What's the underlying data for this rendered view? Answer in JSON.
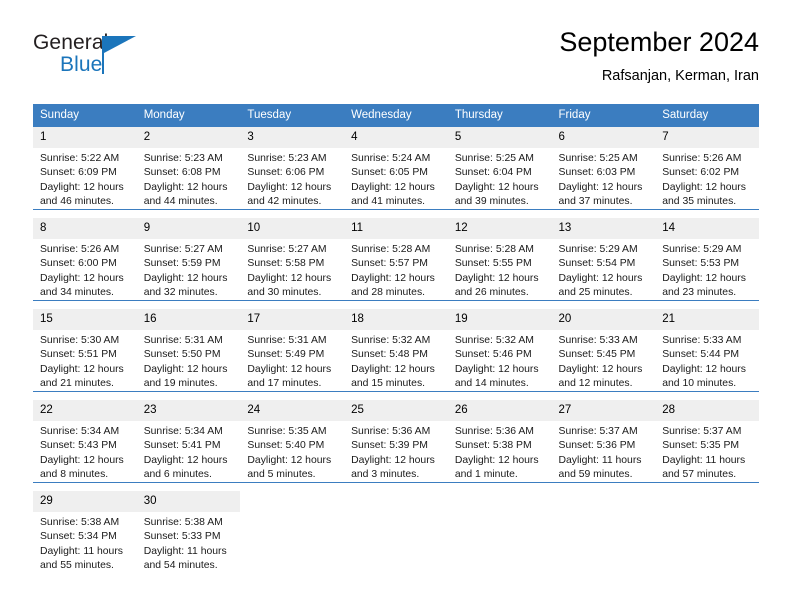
{
  "brand": {
    "name_part1": "General",
    "name_part2": "Blue",
    "flag_icon": "blue-flag-icon",
    "accent_color": "#1b75bb"
  },
  "header": {
    "title": "September 2024",
    "subtitle": "Rafsanjan, Kerman, Iran"
  },
  "calendar": {
    "header_bg": "#3b7dc0",
    "daynum_bg": "#efefef",
    "separator_color": "#3b7dc0",
    "weekday_headers": [
      "Sunday",
      "Monday",
      "Tuesday",
      "Wednesday",
      "Thursday",
      "Friday",
      "Saturday"
    ],
    "weeks": [
      [
        {
          "day": "1",
          "sunrise": "Sunrise: 5:22 AM",
          "sunset": "Sunset: 6:09 PM",
          "daylight1": "Daylight: 12 hours",
          "daylight2": "and 46 minutes."
        },
        {
          "day": "2",
          "sunrise": "Sunrise: 5:23 AM",
          "sunset": "Sunset: 6:08 PM",
          "daylight1": "Daylight: 12 hours",
          "daylight2": "and 44 minutes."
        },
        {
          "day": "3",
          "sunrise": "Sunrise: 5:23 AM",
          "sunset": "Sunset: 6:06 PM",
          "daylight1": "Daylight: 12 hours",
          "daylight2": "and 42 minutes."
        },
        {
          "day": "4",
          "sunrise": "Sunrise: 5:24 AM",
          "sunset": "Sunset: 6:05 PM",
          "daylight1": "Daylight: 12 hours",
          "daylight2": "and 41 minutes."
        },
        {
          "day": "5",
          "sunrise": "Sunrise: 5:25 AM",
          "sunset": "Sunset: 6:04 PM",
          "daylight1": "Daylight: 12 hours",
          "daylight2": "and 39 minutes."
        },
        {
          "day": "6",
          "sunrise": "Sunrise: 5:25 AM",
          "sunset": "Sunset: 6:03 PM",
          "daylight1": "Daylight: 12 hours",
          "daylight2": "and 37 minutes."
        },
        {
          "day": "7",
          "sunrise": "Sunrise: 5:26 AM",
          "sunset": "Sunset: 6:02 PM",
          "daylight1": "Daylight: 12 hours",
          "daylight2": "and 35 minutes."
        }
      ],
      [
        {
          "day": "8",
          "sunrise": "Sunrise: 5:26 AM",
          "sunset": "Sunset: 6:00 PM",
          "daylight1": "Daylight: 12 hours",
          "daylight2": "and 34 minutes."
        },
        {
          "day": "9",
          "sunrise": "Sunrise: 5:27 AM",
          "sunset": "Sunset: 5:59 PM",
          "daylight1": "Daylight: 12 hours",
          "daylight2": "and 32 minutes."
        },
        {
          "day": "10",
          "sunrise": "Sunrise: 5:27 AM",
          "sunset": "Sunset: 5:58 PM",
          "daylight1": "Daylight: 12 hours",
          "daylight2": "and 30 minutes."
        },
        {
          "day": "11",
          "sunrise": "Sunrise: 5:28 AM",
          "sunset": "Sunset: 5:57 PM",
          "daylight1": "Daylight: 12 hours",
          "daylight2": "and 28 minutes."
        },
        {
          "day": "12",
          "sunrise": "Sunrise: 5:28 AM",
          "sunset": "Sunset: 5:55 PM",
          "daylight1": "Daylight: 12 hours",
          "daylight2": "and 26 minutes."
        },
        {
          "day": "13",
          "sunrise": "Sunrise: 5:29 AM",
          "sunset": "Sunset: 5:54 PM",
          "daylight1": "Daylight: 12 hours",
          "daylight2": "and 25 minutes."
        },
        {
          "day": "14",
          "sunrise": "Sunrise: 5:29 AM",
          "sunset": "Sunset: 5:53 PM",
          "daylight1": "Daylight: 12 hours",
          "daylight2": "and 23 minutes."
        }
      ],
      [
        {
          "day": "15",
          "sunrise": "Sunrise: 5:30 AM",
          "sunset": "Sunset: 5:51 PM",
          "daylight1": "Daylight: 12 hours",
          "daylight2": "and 21 minutes."
        },
        {
          "day": "16",
          "sunrise": "Sunrise: 5:31 AM",
          "sunset": "Sunset: 5:50 PM",
          "daylight1": "Daylight: 12 hours",
          "daylight2": "and 19 minutes."
        },
        {
          "day": "17",
          "sunrise": "Sunrise: 5:31 AM",
          "sunset": "Sunset: 5:49 PM",
          "daylight1": "Daylight: 12 hours",
          "daylight2": "and 17 minutes."
        },
        {
          "day": "18",
          "sunrise": "Sunrise: 5:32 AM",
          "sunset": "Sunset: 5:48 PM",
          "daylight1": "Daylight: 12 hours",
          "daylight2": "and 15 minutes."
        },
        {
          "day": "19",
          "sunrise": "Sunrise: 5:32 AM",
          "sunset": "Sunset: 5:46 PM",
          "daylight1": "Daylight: 12 hours",
          "daylight2": "and 14 minutes."
        },
        {
          "day": "20",
          "sunrise": "Sunrise: 5:33 AM",
          "sunset": "Sunset: 5:45 PM",
          "daylight1": "Daylight: 12 hours",
          "daylight2": "and 12 minutes."
        },
        {
          "day": "21",
          "sunrise": "Sunrise: 5:33 AM",
          "sunset": "Sunset: 5:44 PM",
          "daylight1": "Daylight: 12 hours",
          "daylight2": "and 10 minutes."
        }
      ],
      [
        {
          "day": "22",
          "sunrise": "Sunrise: 5:34 AM",
          "sunset": "Sunset: 5:43 PM",
          "daylight1": "Daylight: 12 hours",
          "daylight2": "and 8 minutes."
        },
        {
          "day": "23",
          "sunrise": "Sunrise: 5:34 AM",
          "sunset": "Sunset: 5:41 PM",
          "daylight1": "Daylight: 12 hours",
          "daylight2": "and 6 minutes."
        },
        {
          "day": "24",
          "sunrise": "Sunrise: 5:35 AM",
          "sunset": "Sunset: 5:40 PM",
          "daylight1": "Daylight: 12 hours",
          "daylight2": "and 5 minutes."
        },
        {
          "day": "25",
          "sunrise": "Sunrise: 5:36 AM",
          "sunset": "Sunset: 5:39 PM",
          "daylight1": "Daylight: 12 hours",
          "daylight2": "and 3 minutes."
        },
        {
          "day": "26",
          "sunrise": "Sunrise: 5:36 AM",
          "sunset": "Sunset: 5:38 PM",
          "daylight1": "Daylight: 12 hours",
          "daylight2": "and 1 minute."
        },
        {
          "day": "27",
          "sunrise": "Sunrise: 5:37 AM",
          "sunset": "Sunset: 5:36 PM",
          "daylight1": "Daylight: 11 hours",
          "daylight2": "and 59 minutes."
        },
        {
          "day": "28",
          "sunrise": "Sunrise: 5:37 AM",
          "sunset": "Sunset: 5:35 PM",
          "daylight1": "Daylight: 11 hours",
          "daylight2": "and 57 minutes."
        }
      ],
      [
        {
          "day": "29",
          "sunrise": "Sunrise: 5:38 AM",
          "sunset": "Sunset: 5:34 PM",
          "daylight1": "Daylight: 11 hours",
          "daylight2": "and 55 minutes."
        },
        {
          "day": "30",
          "sunrise": "Sunrise: 5:38 AM",
          "sunset": "Sunset: 5:33 PM",
          "daylight1": "Daylight: 11 hours",
          "daylight2": "and 54 minutes."
        },
        {
          "day": "",
          "sunrise": "",
          "sunset": "",
          "daylight1": "",
          "daylight2": ""
        },
        {
          "day": "",
          "sunrise": "",
          "sunset": "",
          "daylight1": "",
          "daylight2": ""
        },
        {
          "day": "",
          "sunrise": "",
          "sunset": "",
          "daylight1": "",
          "daylight2": ""
        },
        {
          "day": "",
          "sunrise": "",
          "sunset": "",
          "daylight1": "",
          "daylight2": ""
        },
        {
          "day": "",
          "sunrise": "",
          "sunset": "",
          "daylight1": "",
          "daylight2": ""
        }
      ]
    ]
  }
}
